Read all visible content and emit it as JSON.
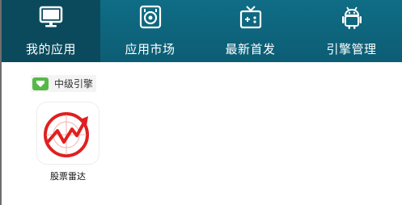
{
  "nav": {
    "tabs": [
      {
        "label": "我的应用",
        "icon": "monitor-icon",
        "active": true
      },
      {
        "label": "应用市场",
        "icon": "store-icon",
        "active": false
      },
      {
        "label": "最新首发",
        "icon": "gamepad-icon",
        "active": false
      },
      {
        "label": "引擎管理",
        "icon": "android-icon",
        "active": false
      }
    ]
  },
  "section": {
    "title": "中级引擎",
    "badge_color": "#56b947"
  },
  "apps": [
    {
      "name": "股票雷达",
      "icon": "stock-radar-icon",
      "accent_color": "#e02020"
    }
  ],
  "colors": {
    "header_bg": "#0f6d85",
    "active_tab_bg": "#0a4a5c"
  }
}
